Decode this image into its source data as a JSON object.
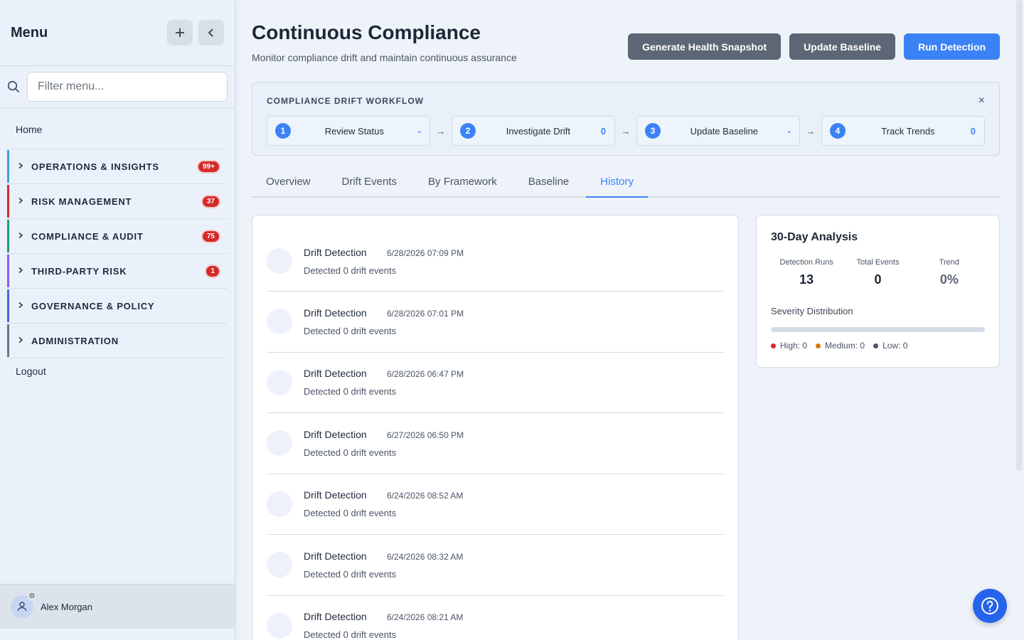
{
  "sidebar": {
    "title": "Menu",
    "add_icon": "plus-icon",
    "collapse_icon": "chevron-left-icon",
    "search_placeholder": "Filter menu...",
    "home": "Home",
    "sections": [
      {
        "label": "OPERATIONS & INSIGHTS",
        "badge": "99+",
        "color": "#3aa3d9"
      },
      {
        "label": "RISK MANAGEMENT",
        "badge": "37",
        "color": "#d42a2a"
      },
      {
        "label": "COMPLIANCE & AUDIT",
        "badge": "75",
        "color": "#1f9e6e"
      },
      {
        "label": "THIRD-PARTY RISK",
        "badge": "1",
        "color": "#8b5cf6"
      },
      {
        "label": "GOVERNANCE & POLICY",
        "badge": "",
        "color": "#3b6fd9"
      },
      {
        "label": "ADMINISTRATION",
        "badge": "",
        "color": "#6b7480"
      }
    ],
    "logout": "Logout",
    "user_name": "Alex Morgan"
  },
  "header": {
    "title": "Continuous Compliance",
    "subtitle": "Monitor compliance drift and maintain continuous assurance",
    "btn_snapshot": "Generate Health Snapshot",
    "btn_baseline": "Update Baseline",
    "btn_run": "Run Detection"
  },
  "workflow": {
    "title": "COMPLIANCE DRIFT WORKFLOW",
    "close": "×",
    "steps": [
      {
        "num": "1",
        "label": "Review Status",
        "count": "-"
      },
      {
        "num": "2",
        "label": "Investigate Drift",
        "count": "0"
      },
      {
        "num": "3",
        "label": "Update Baseline",
        "count": "-"
      },
      {
        "num": "4",
        "label": "Track Trends",
        "count": "0"
      }
    ],
    "arrow": "→"
  },
  "tabs": [
    "Overview",
    "Drift Events",
    "By Framework",
    "Baseline",
    "History"
  ],
  "active_tab": "History",
  "history": [
    {
      "title": "Drift Detection",
      "time": "6/28/2026 07:09 PM",
      "desc": "Detected 0 drift events"
    },
    {
      "title": "Drift Detection",
      "time": "6/28/2026 07:01 PM",
      "desc": "Detected 0 drift events"
    },
    {
      "title": "Drift Detection",
      "time": "6/28/2026 06:47 PM",
      "desc": "Detected 0 drift events"
    },
    {
      "title": "Drift Detection",
      "time": "6/27/2026 06:50 PM",
      "desc": "Detected 0 drift events"
    },
    {
      "title": "Drift Detection",
      "time": "6/24/2026 08:52 AM",
      "desc": "Detected 0 drift events"
    },
    {
      "title": "Drift Detection",
      "time": "6/24/2026 08:32 AM",
      "desc": "Detected 0 drift events"
    },
    {
      "title": "Drift Detection",
      "time": "6/24/2026 08:21 AM",
      "desc": "Detected 0 drift events"
    }
  ],
  "analysis": {
    "title": "30-Day Analysis",
    "runs_label": "Detection Runs",
    "runs_value": "13",
    "events_label": "Total Events",
    "events_value": "0",
    "trend_label": "Trend",
    "trend_value": "0%",
    "severity_label": "Severity Distribution",
    "legend": [
      {
        "label": "High: 0",
        "color": "#d42a2a"
      },
      {
        "label": "Medium: 0",
        "color": "#d97706"
      },
      {
        "label": "Low: 0",
        "color": "#4b5565"
      }
    ]
  },
  "help_icon": "question-circle-icon"
}
